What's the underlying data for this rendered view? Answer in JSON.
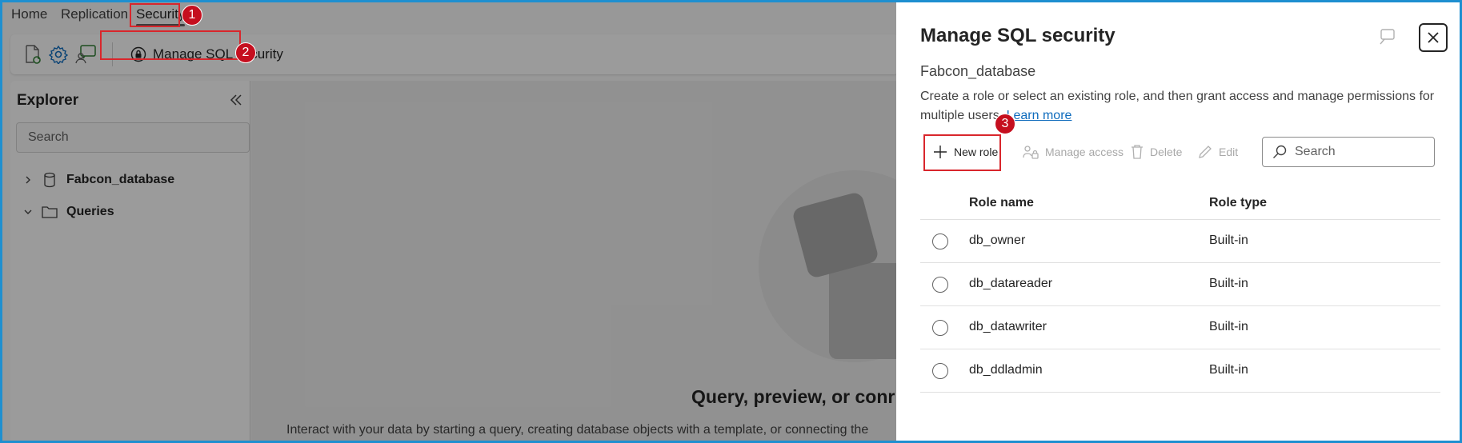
{
  "tabs": [
    {
      "label": "Home"
    },
    {
      "label": "Replication"
    },
    {
      "label": "Security"
    }
  ],
  "callouts": [
    "1",
    "2",
    "3"
  ],
  "toolbar": {
    "manage_label": "Manage SQL security"
  },
  "explorer": {
    "title": "Explorer",
    "search_placeholder": "Search",
    "items": [
      {
        "label": "Fabcon_database"
      },
      {
        "label": "Queries"
      }
    ]
  },
  "main": {
    "title": "Query, preview, or conr",
    "subtitle": "Interact with your data by starting a query, creating database objects with a template, or connecting the"
  },
  "panel": {
    "title": "Manage SQL security",
    "database": "Fabcon_database",
    "description": "Create a role or select an existing role, and then grant access and manage permissions for multiple users.",
    "learn_more": "Learn more",
    "commands": {
      "new_role": "New role",
      "manage_access": "Manage access",
      "delete": "Delete",
      "edit": "Edit"
    },
    "search_placeholder": "Search",
    "columns": {
      "role_name": "Role name",
      "role_type": "Role type"
    },
    "rows": [
      {
        "name": "db_owner",
        "type": "Built-in"
      },
      {
        "name": "db_datareader",
        "type": "Built-in"
      },
      {
        "name": "db_datawriter",
        "type": "Built-in"
      },
      {
        "name": "db_ddladmin",
        "type": "Built-in"
      }
    ]
  },
  "colors": {
    "callout": "#c50f1f",
    "link": "#0f6cbd",
    "frame": "#1e8fd0"
  }
}
